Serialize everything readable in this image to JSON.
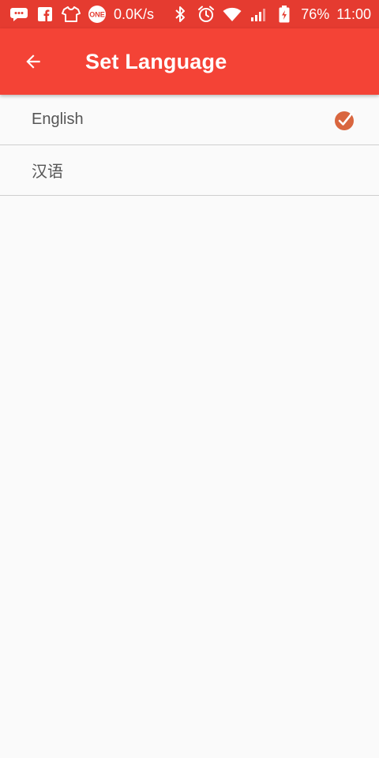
{
  "status_bar": {
    "icons_left": [
      "chat-icon",
      "facebook-icon",
      "shirt-icon",
      "one-icon"
    ],
    "one_badge": "ONE",
    "network_speed": "0.0K/s",
    "icons_right": [
      "bluetooth-icon",
      "alarm-icon",
      "wifi-icon",
      "signal-icon",
      "battery-icon"
    ],
    "battery": "76%",
    "time": "11:00"
  },
  "app_bar": {
    "title": "Set Language",
    "back_icon": "arrow-left-icon",
    "background": "#f44336"
  },
  "languages": [
    {
      "label": "English",
      "selected": true
    },
    {
      "label": "汉语",
      "selected": false
    }
  ],
  "colors": {
    "status_bar": "#e53b30",
    "app_bar": "#f44336",
    "check": "#d9663f",
    "background": "#fafafa"
  }
}
